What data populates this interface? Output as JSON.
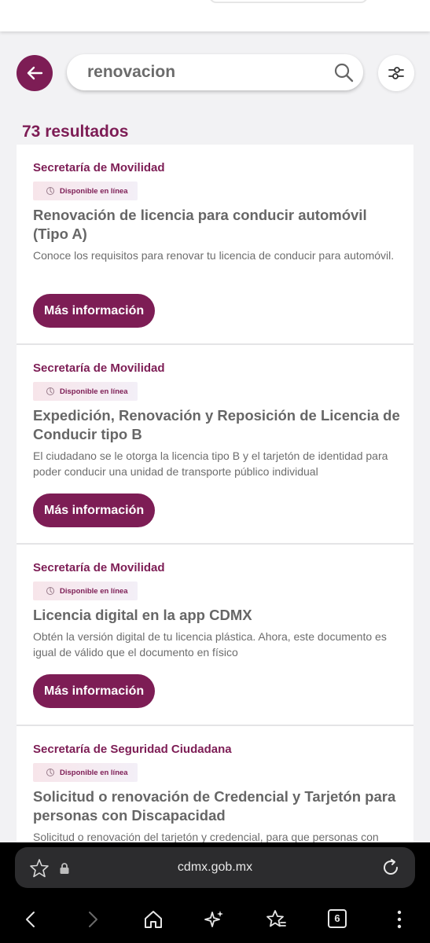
{
  "search": {
    "query": "renovacion",
    "placeholder": ""
  },
  "results_summary": "73 resultados",
  "results": [
    {
      "agency": "Secretaría de Movilidad",
      "badge": "Disponible en línea",
      "title": "Renovación de licencia para conducir automóvil (Tipo A)",
      "description": "Conoce los requisitos para renovar tu licencia de conducir para automóvil.",
      "button": "Más información"
    },
    {
      "agency": "Secretaría de Movilidad",
      "badge": "Disponible en línea",
      "title": "Expedición, Renovación y Reposición de Licencia de Conducir tipo B",
      "description": "El ciudadano se le otorga la licencia tipo B y el tarjetón de identidad para poder conducir una unidad de transporte público individual",
      "button": "Más información"
    },
    {
      "agency": "Secretaría de Movilidad",
      "badge": "Disponible en línea",
      "title": "Licencia digital en la app CDMX",
      "description": "Obtén la versión digital de tu licencia plástica. Ahora, este documento es igual de válido que el documento en físico",
      "button": "Más información"
    },
    {
      "agency": "Secretaría de Seguridad Ciudadana",
      "badge": "Disponible en línea",
      "title": "Solicitud o renovación de Credencial y Tarjetón para personas con Discapacidad",
      "description": "Solicitud o renovación del tarjetón y credencial, para que personas con"
    }
  ],
  "browser": {
    "url": "cdmx.gob.mx",
    "tab_count": "6"
  },
  "icons": {
    "back": "arrow-left-icon",
    "search": "search-icon",
    "filter": "sliders-icon",
    "badge": "pointer-icon",
    "bookmark": "star-icon",
    "lock": "lock-icon",
    "reload": "reload-icon",
    "nav": [
      "back-icon",
      "forward-icon",
      "home-icon",
      "ai-sparkle-icon",
      "bookmarks-icon",
      "tabs-icon",
      "menu-icon"
    ]
  },
  "colors": {
    "brand": "#7d1d55",
    "badge_bg": "#f7e5ea",
    "page_bg": "#f2f2f4",
    "browser_bg": "#000000"
  }
}
